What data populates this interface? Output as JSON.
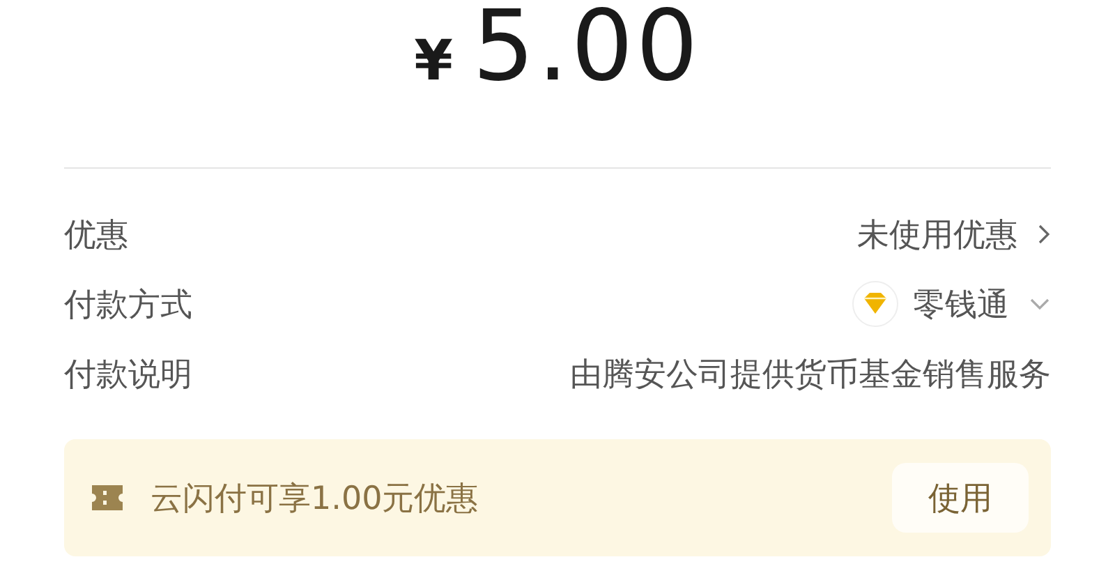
{
  "amount": {
    "currency": "¥",
    "value": "5.00"
  },
  "rows": [
    {
      "label": "优惠",
      "value": "未使用优惠",
      "kind": "link"
    },
    {
      "label": "付款方式",
      "value": "零钱通",
      "kind": "select"
    },
    {
      "label": "付款说明",
      "value": "由腾安公司提供货币基金销售服务",
      "kind": "text"
    }
  ],
  "promo": {
    "text": "云闪付可享1.00元优惠",
    "button": "使用"
  }
}
